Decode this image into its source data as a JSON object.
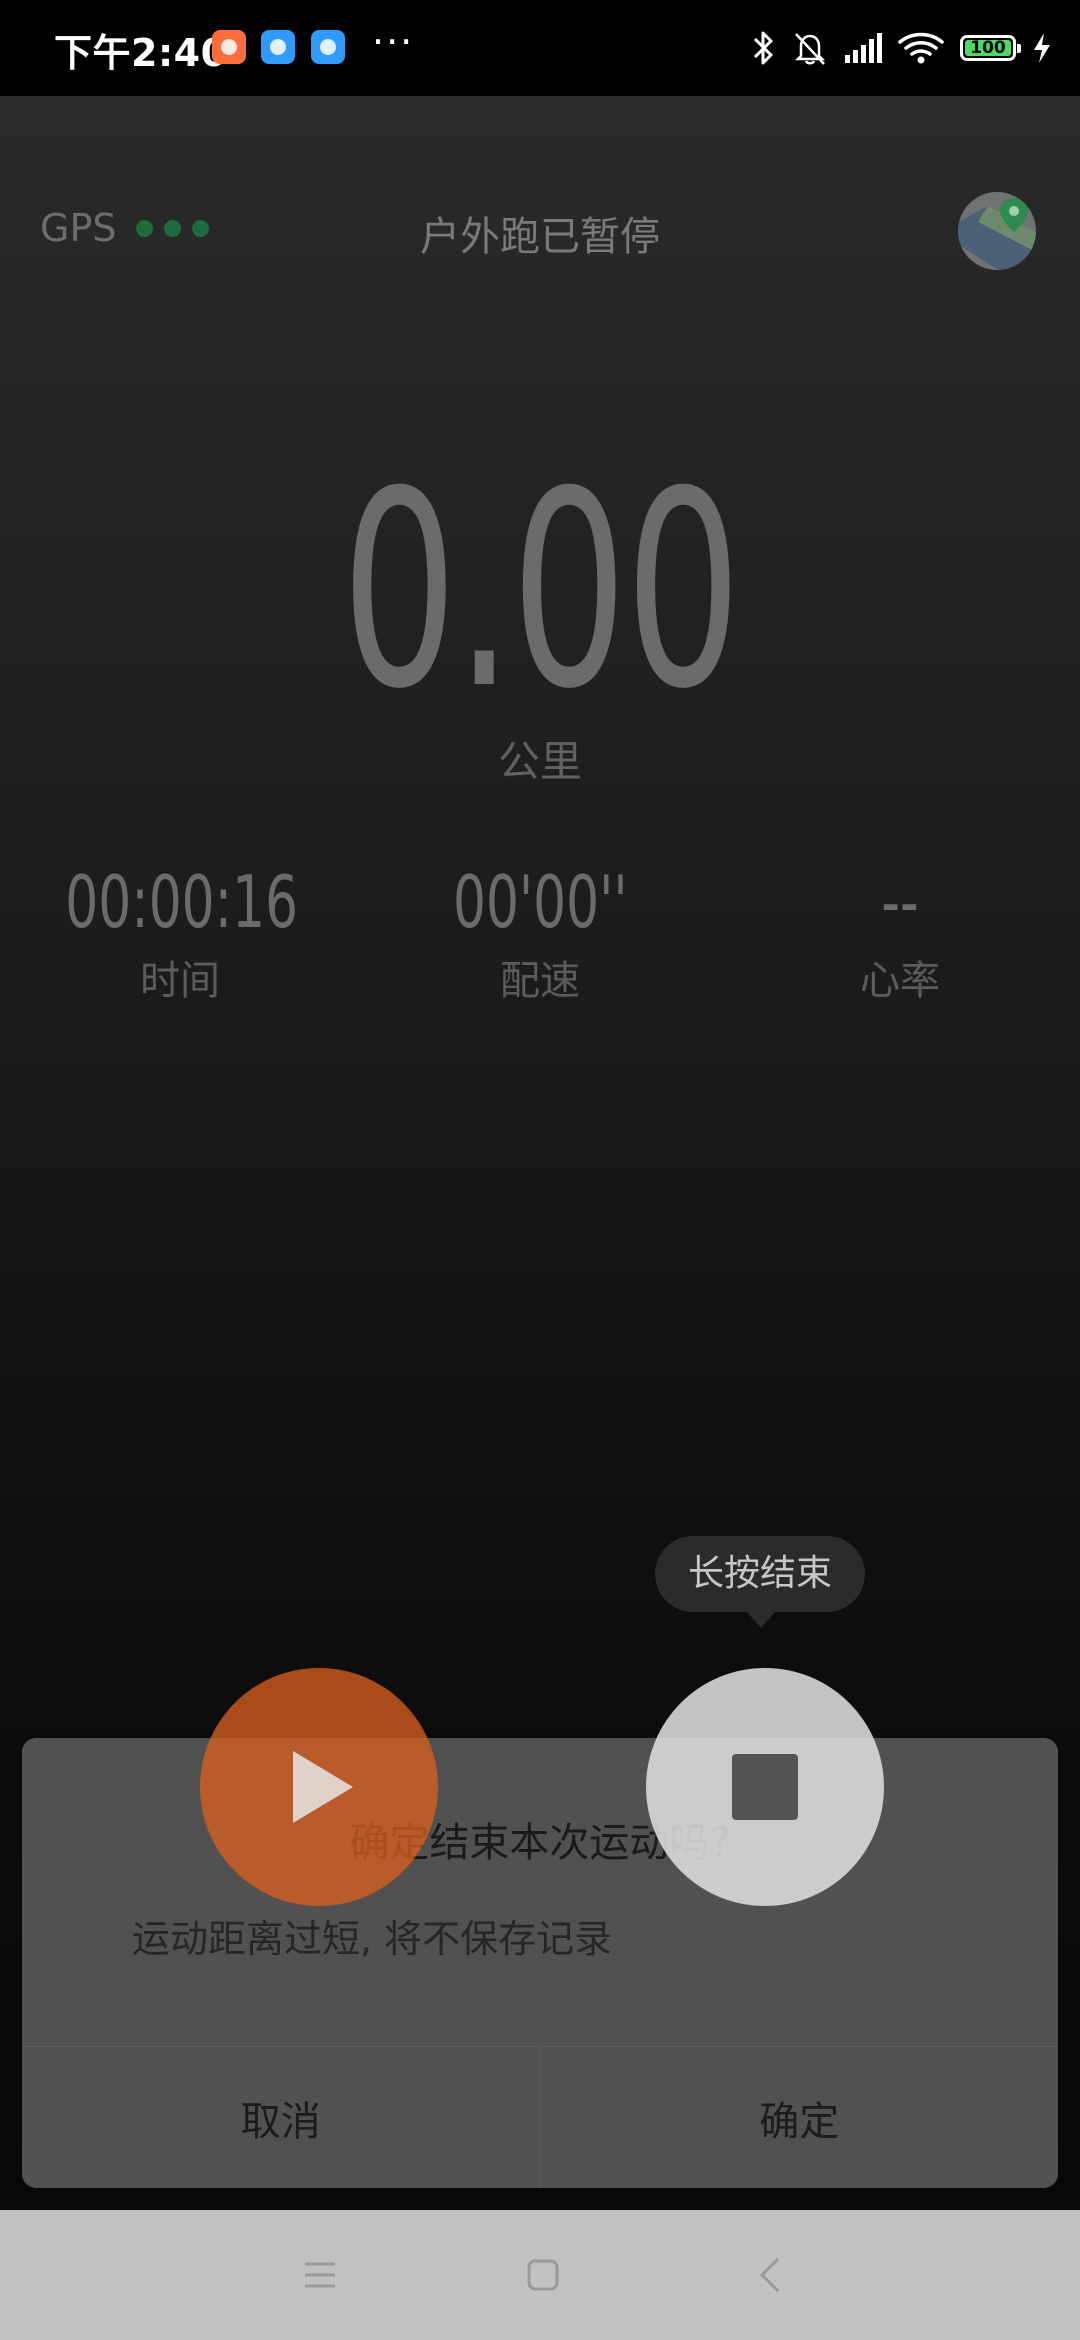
{
  "status_bar": {
    "time": "下午2:40",
    "more": "···",
    "battery": "100",
    "notification_icons": [
      "app-icon-orange",
      "app-icon-blue",
      "app-icon-blue"
    ],
    "system_icons": [
      "bluetooth-icon",
      "mute-bell-icon",
      "signal-icon",
      "wifi-icon",
      "battery-icon",
      "charging-icon"
    ]
  },
  "header": {
    "gps_label": "GPS",
    "gps_dot_color": "#1f6b3d",
    "title": "户外跑已暂停",
    "map_button_icon": "map-pin-icon"
  },
  "distance": {
    "value": "0.00",
    "unit": "公里"
  },
  "stats": [
    {
      "value": "00:00:16",
      "label": "时间"
    },
    {
      "value": "00'00''",
      "label": "配速"
    },
    {
      "value": "--",
      "label": "心率"
    }
  ],
  "tooltip": {
    "text": "长按结束"
  },
  "controls": {
    "resume_icon": "play-icon",
    "stop_icon": "stop-icon",
    "resume_color": "#d65f1e",
    "stop_color": "#dddddd"
  },
  "dialog": {
    "title": "确定结束本次运动吗?",
    "message": "运动距离过短, 将不保存记录",
    "cancel_label": "取消",
    "confirm_label": "确定"
  },
  "nav_bar": {
    "icons": [
      "menu-icon",
      "home-icon",
      "back-icon"
    ]
  }
}
